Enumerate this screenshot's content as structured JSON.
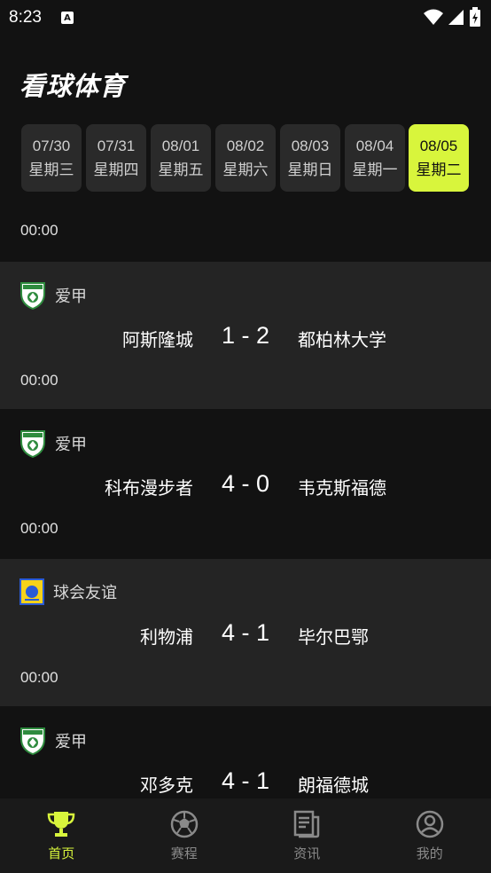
{
  "status": {
    "time": "8:23",
    "a_icon": "A"
  },
  "app": {
    "title": "看球体育"
  },
  "dates": [
    {
      "date": "07/30",
      "weekday": "星期三",
      "active": false
    },
    {
      "date": "07/31",
      "weekday": "星期四",
      "active": false
    },
    {
      "date": "08/01",
      "weekday": "星期五",
      "active": false
    },
    {
      "date": "08/02",
      "weekday": "星期六",
      "active": false
    },
    {
      "date": "08/03",
      "weekday": "星期日",
      "active": false
    },
    {
      "date": "08/04",
      "weekday": "星期一",
      "active": false
    },
    {
      "date": "08/05",
      "weekday": "星期二",
      "active": true
    }
  ],
  "section_time": "00:00",
  "matches": [
    {
      "league": "爱甲",
      "league_icon": "league-badge-icon",
      "home": "阿斯隆城",
      "score": "1 - 2",
      "away": "都柏林大学",
      "time": "00:00"
    },
    {
      "league": "爱甲",
      "league_icon": "league-badge-icon",
      "home": "科布漫步者",
      "score": "4 - 0",
      "away": "韦克斯福德",
      "time": "00:00"
    },
    {
      "league": "球会友谊",
      "league_icon": "club-friendly-icon",
      "home": "利物浦",
      "score": "4 - 1",
      "away": "毕尔巴鄂",
      "time": "00:00"
    },
    {
      "league": "爱甲",
      "league_icon": "league-badge-icon",
      "home": "邓多克",
      "score": "4 - 1",
      "away": "朗福德城",
      "time": ""
    }
  ],
  "tabs": [
    {
      "label": "首页",
      "icon": "trophy-icon",
      "active": true
    },
    {
      "label": "赛程",
      "icon": "football-icon",
      "active": false
    },
    {
      "label": "资讯",
      "icon": "news-icon",
      "active": false
    },
    {
      "label": "我的",
      "icon": "user-icon",
      "active": false
    }
  ],
  "colors": {
    "accent": "#d8f53c",
    "background": "#121212",
    "row_alt": "#242424",
    "chip": "#2a2a2a"
  }
}
